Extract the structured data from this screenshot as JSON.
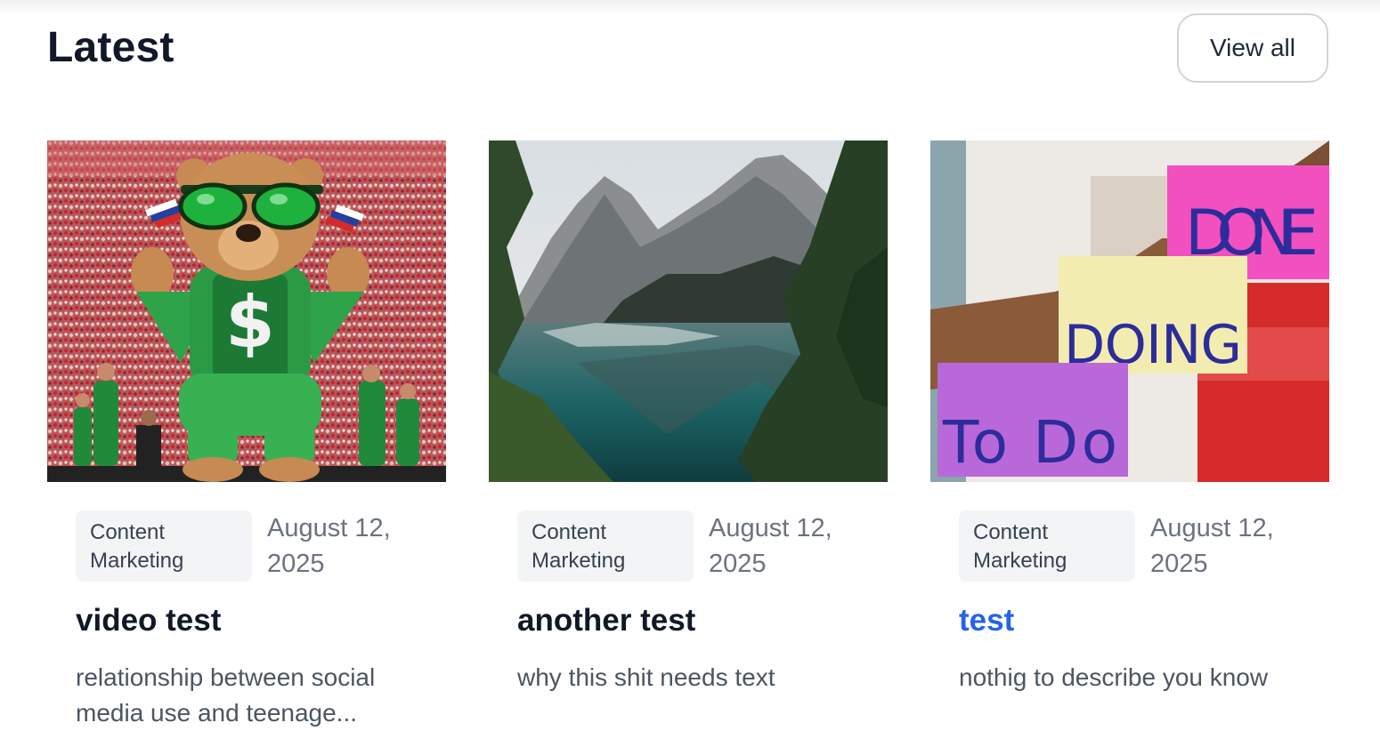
{
  "section": {
    "title": "Latest",
    "view_all_label": "View all"
  },
  "posts": [
    {
      "category": "Content Marketing",
      "date": "August 12, 2025",
      "title": "video test",
      "description": "relationship between social media use and teenage...",
      "image": "bear-in-green-tracksuit-stadium"
    },
    {
      "category": "Content Marketing",
      "date": "August 12, 2025",
      "title": "another test",
      "description": "why this shit needs text",
      "image": "mountain-lake-reflection"
    },
    {
      "category": "Content Marketing",
      "date": "August 12, 2025",
      "title": "test",
      "description": "nothig to describe you know",
      "image": "sticky-notes-todo-doing-done",
      "sticky_notes": [
        "DONE",
        "DOING",
        "To Do"
      ]
    }
  ],
  "colors": {
    "title_text": "#111827",
    "active_link": "#2563eb",
    "muted_text": "#6b7280",
    "tag_background": "#f3f4f6",
    "button_border": "#d1d5db"
  }
}
